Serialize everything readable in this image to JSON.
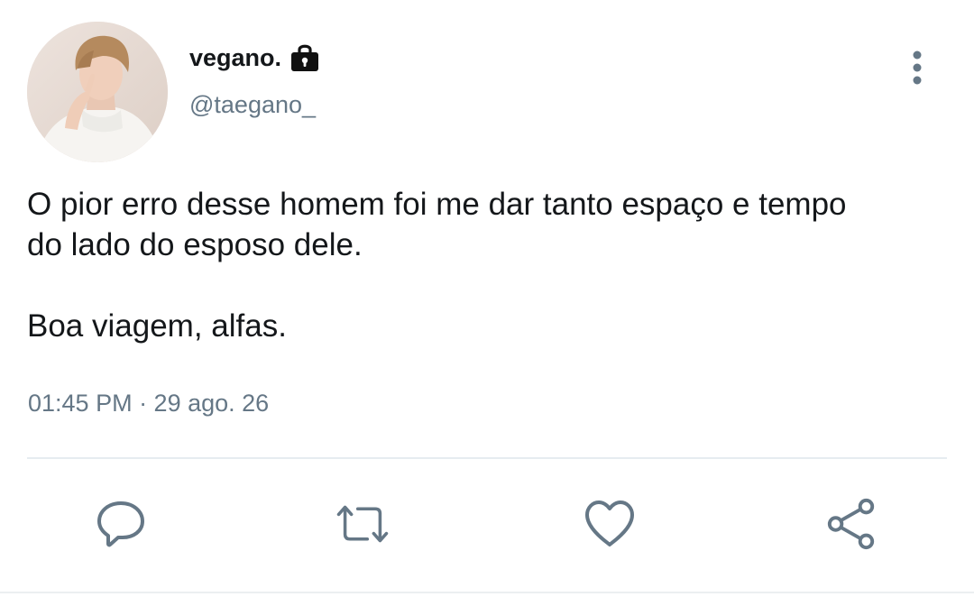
{
  "tweet": {
    "display_name": "vegano.",
    "handle": "@taegano_",
    "text": "O pior erro desse homem foi me dar tanto espaço e tempo\ndo lado do esposo dele.\n\nBoa viagem, alfas.",
    "timestamp": "01:45 PM · 29 ago. 26",
    "verified_lock": true
  },
  "actions": [
    {
      "name": "reply",
      "icon": "reply-icon"
    },
    {
      "name": "retweet",
      "icon": "retweet-icon"
    },
    {
      "name": "like",
      "icon": "heart-icon"
    },
    {
      "name": "share",
      "icon": "share-icon"
    }
  ],
  "colors": {
    "text": "#14171a",
    "secondary": "#657786",
    "divider": "#e6ecf0"
  }
}
